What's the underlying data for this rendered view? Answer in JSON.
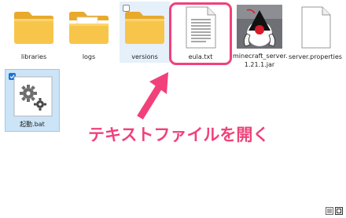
{
  "files": [
    {
      "name": "libraries",
      "type": "folder"
    },
    {
      "name": "logs",
      "type": "folder"
    },
    {
      "name": "versions",
      "type": "folder"
    },
    {
      "name": "eula.txt",
      "type": "text-file"
    },
    {
      "name": "minecraft_server.\n1.21.1.jar",
      "type": "jar-file"
    },
    {
      "name": "server.properties",
      "type": "properties-file"
    },
    {
      "name": "起動.bat",
      "type": "batch-file"
    }
  ],
  "annotation": {
    "text": "テキストファイルを開く",
    "color": "#f0417a"
  },
  "colors": {
    "folder_yellow": "#f8c54b",
    "selection": "#cce4f7",
    "accent": "#f0417a"
  }
}
